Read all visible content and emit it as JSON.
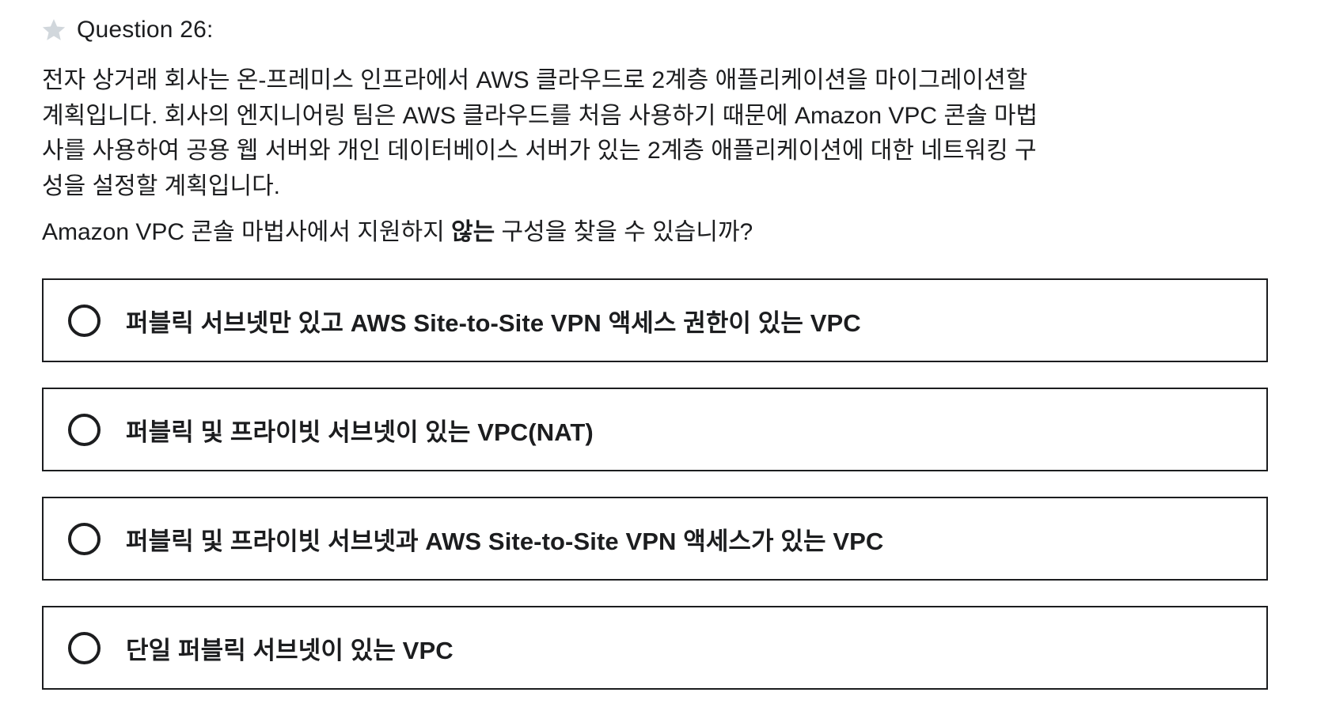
{
  "question": {
    "star_icon": "star-icon",
    "title": "Question 26:",
    "body": "전자 상거래 회사는 온-프레미스 인프라에서 AWS 클라우드로 2계층 애플리케이션을 마이그레이션할 계획입니다. 회사의 엔지니어링 팀은 AWS 클라우드를 처음 사용하기 때문에 Amazon VPC 콘솔 마법사를 사용하여 공용 웹 서버와 개인 데이터베이스 서버가 있는 2계층 애플리케이션에 대한 네트워킹 구성을 설정할 계획입니다.",
    "ask_prefix": "Amazon VPC 콘솔 마법사에서 지원하지 ",
    "ask_emphasis": "않는",
    "ask_suffix": " 구성을 찾을 수 있습니까?"
  },
  "answers": [
    {
      "label": "퍼블릭 서브넷만 있고 AWS Site-to-Site VPN 액세스 권한이 있는 VPC",
      "selected": false
    },
    {
      "label": "퍼블릭 및 프라이빗 서브넷이 있는 VPC(NAT)",
      "selected": false
    },
    {
      "label": "퍼블릭 및 프라이빗 서브넷과 AWS Site-to-Site VPN 액세스가 있는 VPC",
      "selected": false
    },
    {
      "label": "단일 퍼블릭 서브넷이 있는 VPC",
      "selected": false
    }
  ],
  "colors": {
    "text": "#1c1d1f",
    "star": "#d1d7dc",
    "border": "#1c1d1f",
    "background": "#ffffff"
  }
}
